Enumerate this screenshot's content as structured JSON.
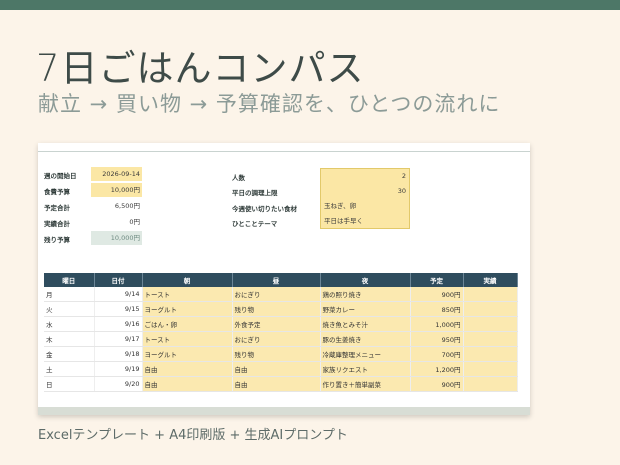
{
  "header": {
    "title": "7日ごはんコンパス",
    "subtitle": "献立 → 買い物 → 予算確認を、ひとつの流れに"
  },
  "sheet": {
    "info_left": [
      {
        "label": "週の開始日",
        "value": "2026-09-14"
      },
      {
        "label": "食費予算",
        "value": "10,000円"
      },
      {
        "label": "予定合計",
        "value": "6,500円"
      },
      {
        "label": "実績合計",
        "value": "0円"
      },
      {
        "label": "残り予算",
        "value": "10,000円"
      }
    ],
    "info_right": [
      {
        "label": "人数",
        "value": "2"
      },
      {
        "label": "平日の調理上限",
        "value": "30"
      },
      {
        "label": "今週使い切りたい食材",
        "value": "玉ねぎ、卵"
      },
      {
        "label": "ひとことテーマ",
        "value": "平日は手早く"
      }
    ],
    "columns": [
      "曜日",
      "日付",
      "朝",
      "昼",
      "夜",
      "予定",
      "実績"
    ],
    "rows": [
      {
        "day": "月",
        "date": "9/14",
        "breakfast": "トースト",
        "lunch": "おにぎり",
        "dinner": "鶏の照り焼き",
        "planned": "900円",
        "actual": ""
      },
      {
        "day": "火",
        "date": "9/15",
        "breakfast": "ヨーグルト",
        "lunch": "残り物",
        "dinner": "野菜カレー",
        "planned": "850円",
        "actual": ""
      },
      {
        "day": "水",
        "date": "9/16",
        "breakfast": "ごはん・卵",
        "lunch": "外食予定",
        "dinner": "焼き魚とみそ汁",
        "planned": "1,000円",
        "actual": ""
      },
      {
        "day": "木",
        "date": "9/17",
        "breakfast": "トースト",
        "lunch": "おにぎり",
        "dinner": "豚の生姜焼き",
        "planned": "950円",
        "actual": ""
      },
      {
        "day": "金",
        "date": "9/18",
        "breakfast": "ヨーグルト",
        "lunch": "残り物",
        "dinner": "冷蔵庫整理メニュー",
        "planned": "700円",
        "actual": ""
      },
      {
        "day": "土",
        "date": "9/19",
        "breakfast": "自由",
        "lunch": "自由",
        "dinner": "家族リクエスト",
        "planned": "1,200円",
        "actual": ""
      },
      {
        "day": "日",
        "date": "9/20",
        "breakfast": "自由",
        "lunch": "自由",
        "dinner": "作り置き＋簡単副菜",
        "planned": "900円",
        "actual": ""
      }
    ]
  },
  "footer": {
    "caption": "Excelテンプレート + A4印刷版 + 生成AIプロンプト"
  },
  "colors": {
    "background": "#fcf4e9",
    "accent_bar": "#4d7767",
    "table_header": "#2f4d5e",
    "input_yellow": "#fbe7a5"
  }
}
